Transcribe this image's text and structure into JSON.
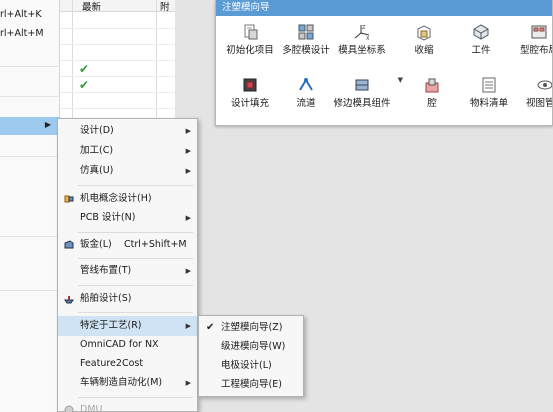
{
  "left_panel": {
    "shortcuts": [
      "rl+Alt+K",
      "rl+Alt+M"
    ]
  },
  "grid": {
    "column_latest": "最新",
    "column_extra": "附"
  },
  "wizard": {
    "title": "注塑模向导",
    "tools": [
      {
        "label": "初始化项目",
        "icon": "init-project-icon"
      },
      {
        "label": "多腔模设计",
        "icon": "multi-cavity-icon"
      },
      {
        "label": "模具坐标系",
        "icon": "csys-icon"
      },
      {
        "label": "收缩",
        "icon": "shrink-icon"
      },
      {
        "label": "工件",
        "icon": "workpiece-icon"
      },
      {
        "label": "型腔布局",
        "icon": "cavity-layout-icon"
      },
      {
        "label": "设计填充",
        "icon": "design-fill-icon"
      },
      {
        "label": "流道",
        "icon": "runner-icon"
      },
      {
        "label": "修边模具组件",
        "icon": "trim-mold-icon"
      },
      {
        "label": "腔",
        "icon": "pocket-icon"
      },
      {
        "label": "物料清单",
        "icon": "bom-icon"
      },
      {
        "label": "视图管理",
        "icon": "view-manager-icon"
      }
    ]
  },
  "main_menu": {
    "items": [
      {
        "label": "设计(D)",
        "submenu": true
      },
      {
        "label": "加工(C)",
        "submenu": true
      },
      {
        "label": "仿真(U)",
        "submenu": true
      },
      {
        "label": "机电概念设计(H)",
        "submenu": false,
        "icon": "mechatronics-icon"
      },
      {
        "label": "PCB 设计(N)",
        "submenu": true
      },
      {
        "label": "钣金(L)",
        "shortcut": "Ctrl+Shift+M",
        "submenu": false,
        "icon": "sheet-metal-icon"
      },
      {
        "label": "管线布置(T)",
        "submenu": true
      },
      {
        "label": "船舶设计(S)",
        "submenu": false,
        "icon": "ship-design-icon"
      },
      {
        "label": "特定于工艺(R)",
        "submenu": true
      },
      {
        "label": "OmniCAD for NX",
        "submenu": false
      },
      {
        "label": "Feature2Cost",
        "submenu": false
      },
      {
        "label": "车辆制造自动化(M)",
        "submenu": true
      },
      {
        "label": "DMU",
        "submenu": false,
        "disabled": true,
        "icon": "dmu-icon"
      }
    ]
  },
  "process_submenu": {
    "items": [
      {
        "label": "注塑模向导(Z)",
        "checked": true
      },
      {
        "label": "级进模向导(W)",
        "checked": false
      },
      {
        "label": "电极设计(L)",
        "checked": false
      },
      {
        "label": "工程模向导(E)",
        "checked": false
      }
    ]
  },
  "colors": {
    "wizard_title_bg": "#5b9bd5",
    "highlight": "#cfe3f4",
    "selected_left": "#9ec9ee",
    "check": "#2f9e2f"
  }
}
